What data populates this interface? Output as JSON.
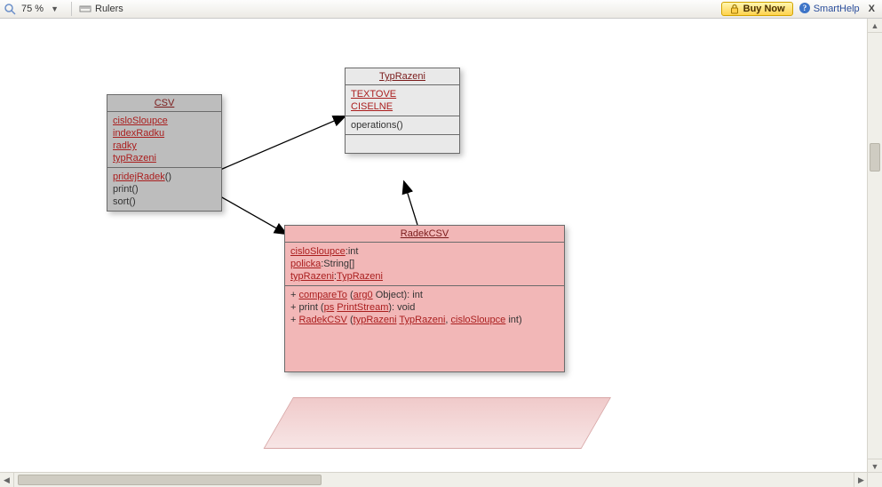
{
  "toolbar": {
    "zoom": "75 %",
    "rulers_label": "Rulers",
    "buy_label": "Buy Now",
    "smarthelp_label": "SmartHelp"
  },
  "classes": {
    "csv": {
      "name": "CSV",
      "attrs": [
        "cisloSloupce",
        "indexRadku",
        "radky",
        "typRazeni"
      ],
      "ops": [
        "pridejRadek()",
        "print()",
        "sort()"
      ]
    },
    "typ": {
      "name": "TypRazeni",
      "attrs": [
        "TEXTOVE",
        "CISELNE"
      ],
      "ops": [
        "operations()"
      ]
    },
    "radek": {
      "name": "RadekCSV",
      "attr_lines": [
        {
          "u": "cisloSloupce",
          "rest": ":int"
        },
        {
          "u": "policka",
          "rest": ":String[]"
        },
        {
          "u": "typRazeni",
          "rest": ":",
          "u2": "TypRazeni"
        }
      ],
      "op_lines": [
        {
          "pre": "+ ",
          "u": "compareTo",
          "mid": " (",
          "u2": "arg0",
          "post": " Object): int"
        },
        {
          "pre": "+ print (",
          "u": "ps",
          "mid": " ",
          "u2": "PrintStream",
          "post": "): void"
        },
        {
          "pre": "+ ",
          "u": "RadekCSV",
          "mid": " (",
          "u2": "typRazeni",
          "mid2": " ",
          "u3": "TypRazeni",
          "mid3": ", ",
          "u4": "cisloSloupce",
          "post": " int)"
        }
      ]
    }
  },
  "chart_data": {
    "type": "uml-class-diagram",
    "classes": [
      {
        "name": "CSV",
        "attributes": [
          "cisloSloupce",
          "indexRadku",
          "radky",
          "typRazeni"
        ],
        "operations": [
          "pridejRadek()",
          "print()",
          "sort()"
        ]
      },
      {
        "name": "TypRazeni",
        "attributes": [
          "TEXTOVE",
          "CISELNE"
        ],
        "operations": [
          "operations()"
        ]
      },
      {
        "name": "RadekCSV",
        "attributes": [
          "cisloSloupce:int",
          "policka:String[]",
          "typRazeni:TypRazeni"
        ],
        "operations": [
          "+ compareTo (arg0 Object): int",
          "+ print (ps PrintStream): void",
          "+ RadekCSV (typRazeni TypRazeni, cisloSloupce int)"
        ]
      }
    ],
    "associations": [
      {
        "from": "CSV",
        "to": "TypRazeni",
        "arrow": "open"
      },
      {
        "from": "CSV",
        "to": "RadekCSV",
        "arrow": "open"
      },
      {
        "from": "RadekCSV",
        "to": "TypRazeni",
        "arrow": "open"
      }
    ]
  }
}
